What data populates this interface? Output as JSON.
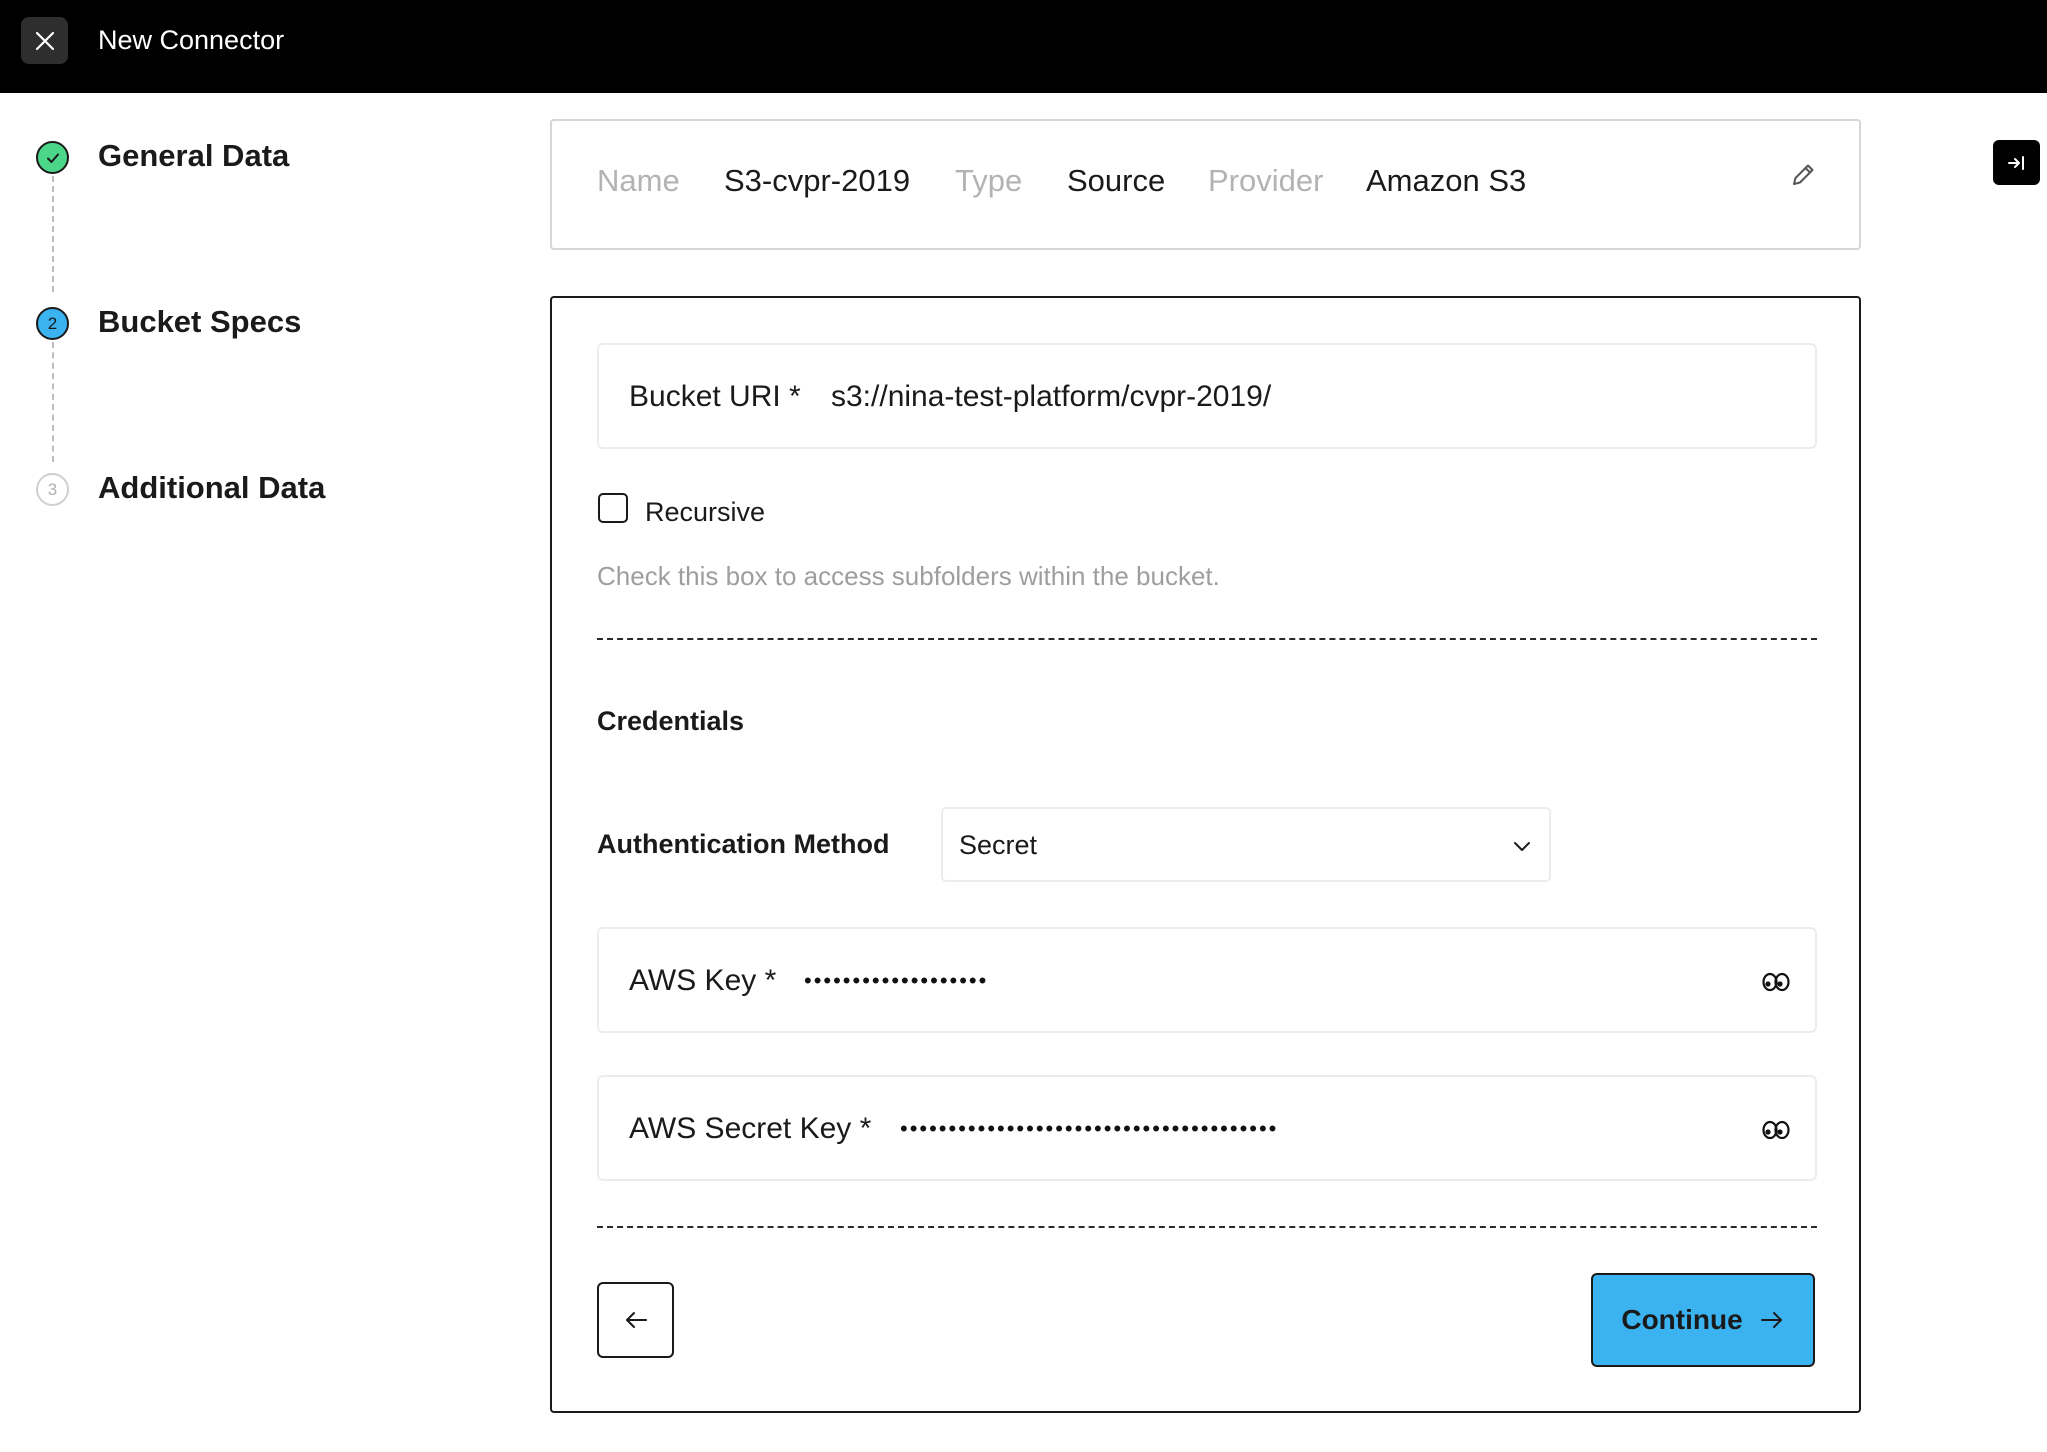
{
  "header": {
    "title": "New Connector",
    "close_icon": "close-icon"
  },
  "stepper": {
    "steps": [
      {
        "number": "1",
        "label": "General Data",
        "state": "completed",
        "color": "#4cd68a"
      },
      {
        "number": "2",
        "label": "Bucket Specs",
        "state": "active",
        "color": "#3bb3f0"
      },
      {
        "number": "3",
        "label": "Additional Data",
        "state": "pending",
        "color": "#bdbdbd"
      }
    ]
  },
  "summary": {
    "name_key": "Name",
    "name_value": "S3-cvpr-2019",
    "type_key": "Type",
    "type_value": "Source",
    "provider_key": "Provider",
    "provider_value": "Amazon S3",
    "edit_icon": "pencil-icon"
  },
  "form": {
    "bucket_uri": {
      "label": "Bucket URI *",
      "value": "s3://nina-test-platform/cvpr-2019/"
    },
    "recursive": {
      "label": "Recursive",
      "checked": false,
      "help": "Check this box to access subfolders within the bucket."
    },
    "credentials_title": "Credentials",
    "auth_method": {
      "label": "Authentication Method",
      "value": "Secret"
    },
    "aws_key": {
      "label": "AWS Key *",
      "masked": "•••••••••••••••••••"
    },
    "aws_secret_key": {
      "label": "AWS Secret Key *",
      "masked": "•••••••••••••••••••••••••••••••••••••••"
    }
  },
  "actions": {
    "continue_label": "Continue",
    "back_icon": "arrow-left-icon",
    "continue_icon": "arrow-right-icon"
  },
  "colors": {
    "accent": "#3bb3f0",
    "success": "#4cd68a",
    "topbar": "#000000"
  }
}
